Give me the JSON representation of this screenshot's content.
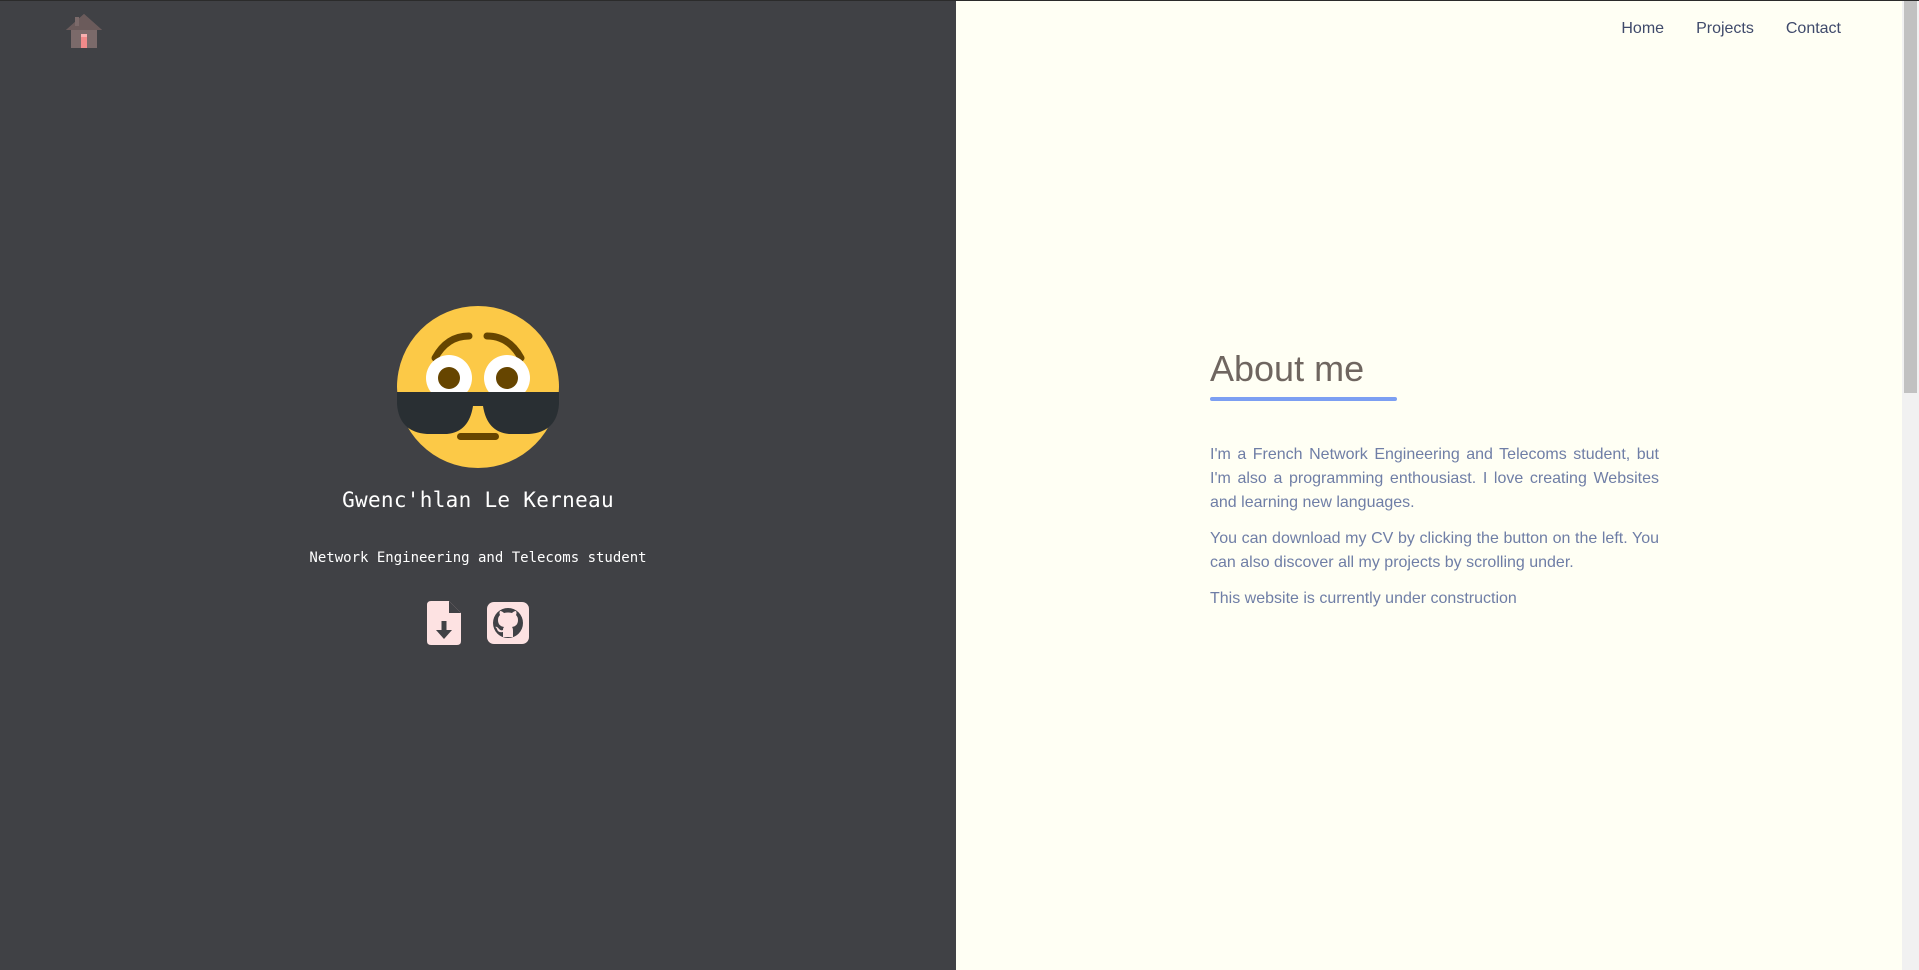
{
  "header": {
    "home_icon": "house-icon",
    "nav": [
      {
        "label": "Home"
      },
      {
        "label": "Projects"
      },
      {
        "label": "Contact"
      }
    ]
  },
  "profile": {
    "avatar_icon": "flushed-sunglasses-emoji",
    "name": "Gwenc'hlan Le Kerneau",
    "tagline": "Network Engineering and Telecoms student",
    "actions": [
      {
        "icon": "download-file-icon"
      },
      {
        "icon": "github-icon"
      }
    ]
  },
  "about": {
    "heading": "About me",
    "paragraphs": [
      "I'm a French Network Engineering and Telecoms student, but I'm also a programming enthousiast. I love creating Websites and learning new languages.",
      "You can download my CV by clicking the button on the left. You can also discover all my projects by scrolling under.",
      "This website is currently under construction"
    ]
  },
  "colors": {
    "left_bg": "#404145",
    "right_bg": "#fffff4",
    "accent": "#7c9ff2",
    "heading": "#6f6660",
    "body_text": "#6f7ea6",
    "nav_text": "#3f4a6b",
    "icon_bg": "#fde2e2"
  }
}
